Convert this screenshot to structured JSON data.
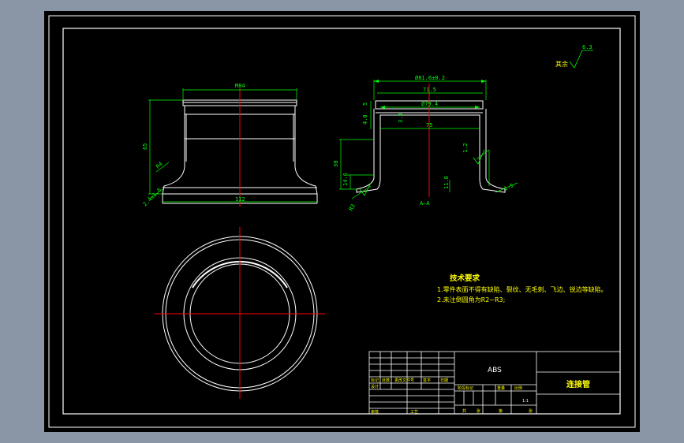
{
  "palette": {
    "background": "#8a96a6",
    "drawing": "#000000",
    "outline": "#ffffff",
    "dimension": "#00ff00",
    "centerline": "#ff0000",
    "text": "#ffff00"
  },
  "front_view": {
    "dim_top": "M84",
    "dim_height": "65",
    "dim_radius": "R4",
    "dim_flange": "2.4±1.6",
    "dim_bottom": "112"
  },
  "section_view": {
    "dim_outer": "Ø81.6±0.2",
    "dim_d1": "71.5",
    "dim_d2": "Ø79.4",
    "dim_d3": "75",
    "dim_h_small": "5",
    "dim_h_top": "4.0",
    "dim_wall": "3.3",
    "dim_total": "30",
    "dim_base": "14.6",
    "dim_tol": "1.2",
    "dim_thk": "11.8",
    "dim_lip": "1.5",
    "dim_slope": "R3",
    "label": "A—A"
  },
  "roughness": {
    "label": "其余",
    "value": "6.3"
  },
  "tech_notes": {
    "title": "技术要求",
    "items": [
      "1.零件表面不得有缺陷、裂纹、无毛刺、飞边、锐边等缺陷。",
      "2.未注倒圆角为R2~R3;"
    ]
  },
  "title_block": {
    "material": "ABS",
    "part_name": "连接管",
    "scale": "1:1",
    "labels": {
      "mark": "标记",
      "count": "处数",
      "zone": "更改文件号",
      "sign": "签字",
      "date": "日期",
      "design": "设计",
      "review": "审核",
      "craft": "工艺",
      "approve": "批准",
      "stage": "阶段标记",
      "weight": "重量",
      "ratio": "比例",
      "sheets": "共",
      "sheet": "张",
      "page": "第"
    }
  }
}
